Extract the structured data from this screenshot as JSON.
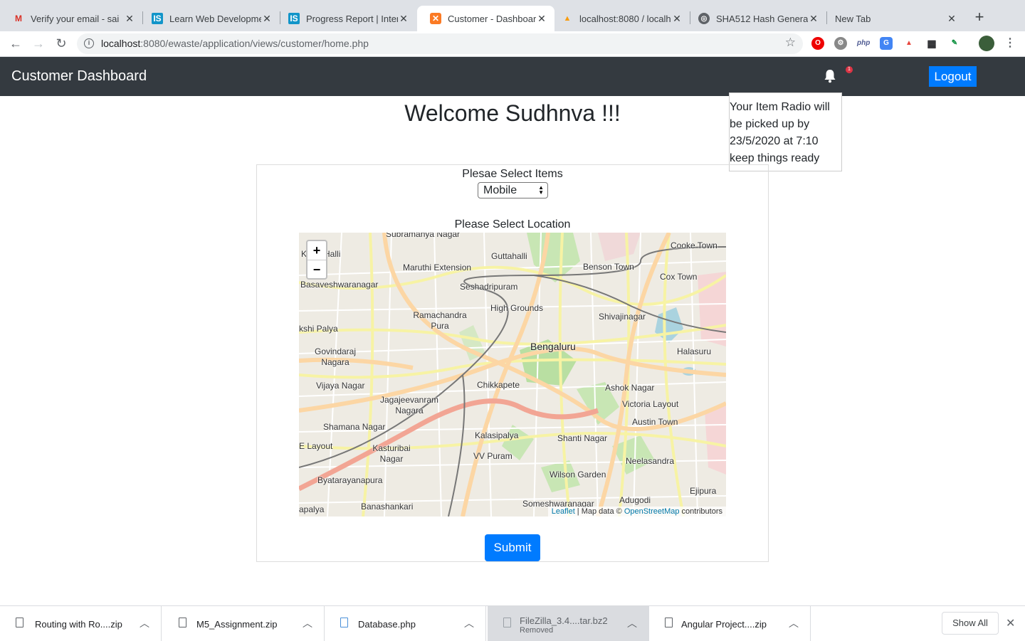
{
  "browser": {
    "tabs": [
      {
        "title": "Verify your email - sai",
        "icon": "gmail-icon"
      },
      {
        "title": "Learn Web Developme",
        "icon": "internshala-icon"
      },
      {
        "title": "Progress Report | Inter",
        "icon": "internshala-icon"
      },
      {
        "title": "Customer - Dashboard",
        "icon": "xampp-icon",
        "active": true
      },
      {
        "title": "localhost:8080 / localh",
        "icon": "phpmyadmin-icon"
      },
      {
        "title": "SHA512 Hash Generat",
        "icon": "globe-icon"
      },
      {
        "title": "New Tab",
        "icon": ""
      }
    ],
    "url_host": "localhost",
    "url_rest": ":8080/ewaste/application/views/customer/home.php"
  },
  "navbar": {
    "brand": "Customer Dashboard",
    "notification_count": "1",
    "logout_label": "Logout"
  },
  "notification": {
    "message": "Your Item Radio will be picked up by 23/5/2020 at 7:10 keep things ready"
  },
  "welcome": "Welcome Sudhnva !!!",
  "form": {
    "items_label": "Plesae Select Items",
    "items_selected": "Mobile",
    "location_label": "Please Select Location",
    "submit_label": "Submit"
  },
  "map": {
    "zoom_in": "+",
    "zoom_out": "−",
    "attribution_leaflet": "Leaflet",
    "attribution_mid": " | Map data © ",
    "attribution_osm": "OpenStreetMap",
    "attribution_end": " contributors",
    "labels": [
      "Subramanya Nagar",
      "Guttahalli",
      "Cooke Town",
      "K ara Halli",
      "Maruthi Extension",
      "Benson Town",
      "Cox Town",
      "Basaveshwaranagar",
      "Seshadripuram",
      "High Grounds",
      "Ramachandra Pura",
      "Shivajinagar",
      "kshi Palya",
      "Bengaluru",
      "Halasuru",
      "Govindaraj Nagara",
      "Chikkapete",
      "Ashok Nagar",
      "Vijaya Nagar",
      "Jagajeevanram Nagara",
      "Victoria Layout",
      "Austin Town",
      "Shamana Nagar",
      "Kalasipalya",
      "Shanti Nagar",
      "Kasturibai Nagar",
      "VV Puram",
      "Neelasandra",
      "E Layout",
      "Wilson Garden",
      "Byatarayanapura",
      "Ejipura",
      "Banashankari",
      "Someshwaranagar",
      "Adugodi",
      "apalya"
    ]
  },
  "downloads": [
    {
      "name": "Routing with Ro....zip",
      "status": ""
    },
    {
      "name": "M5_Assignment.zip",
      "status": ""
    },
    {
      "name": "Database.php",
      "status": ""
    },
    {
      "name": "FileZilla_3.4....tar.bz2",
      "status": "Removed"
    },
    {
      "name": "Angular Project....zip",
      "status": ""
    }
  ],
  "show_all_label": "Show All",
  "colors": {
    "navbar": "#343a40",
    "primary": "#007bff",
    "badge": "#dc3545"
  }
}
